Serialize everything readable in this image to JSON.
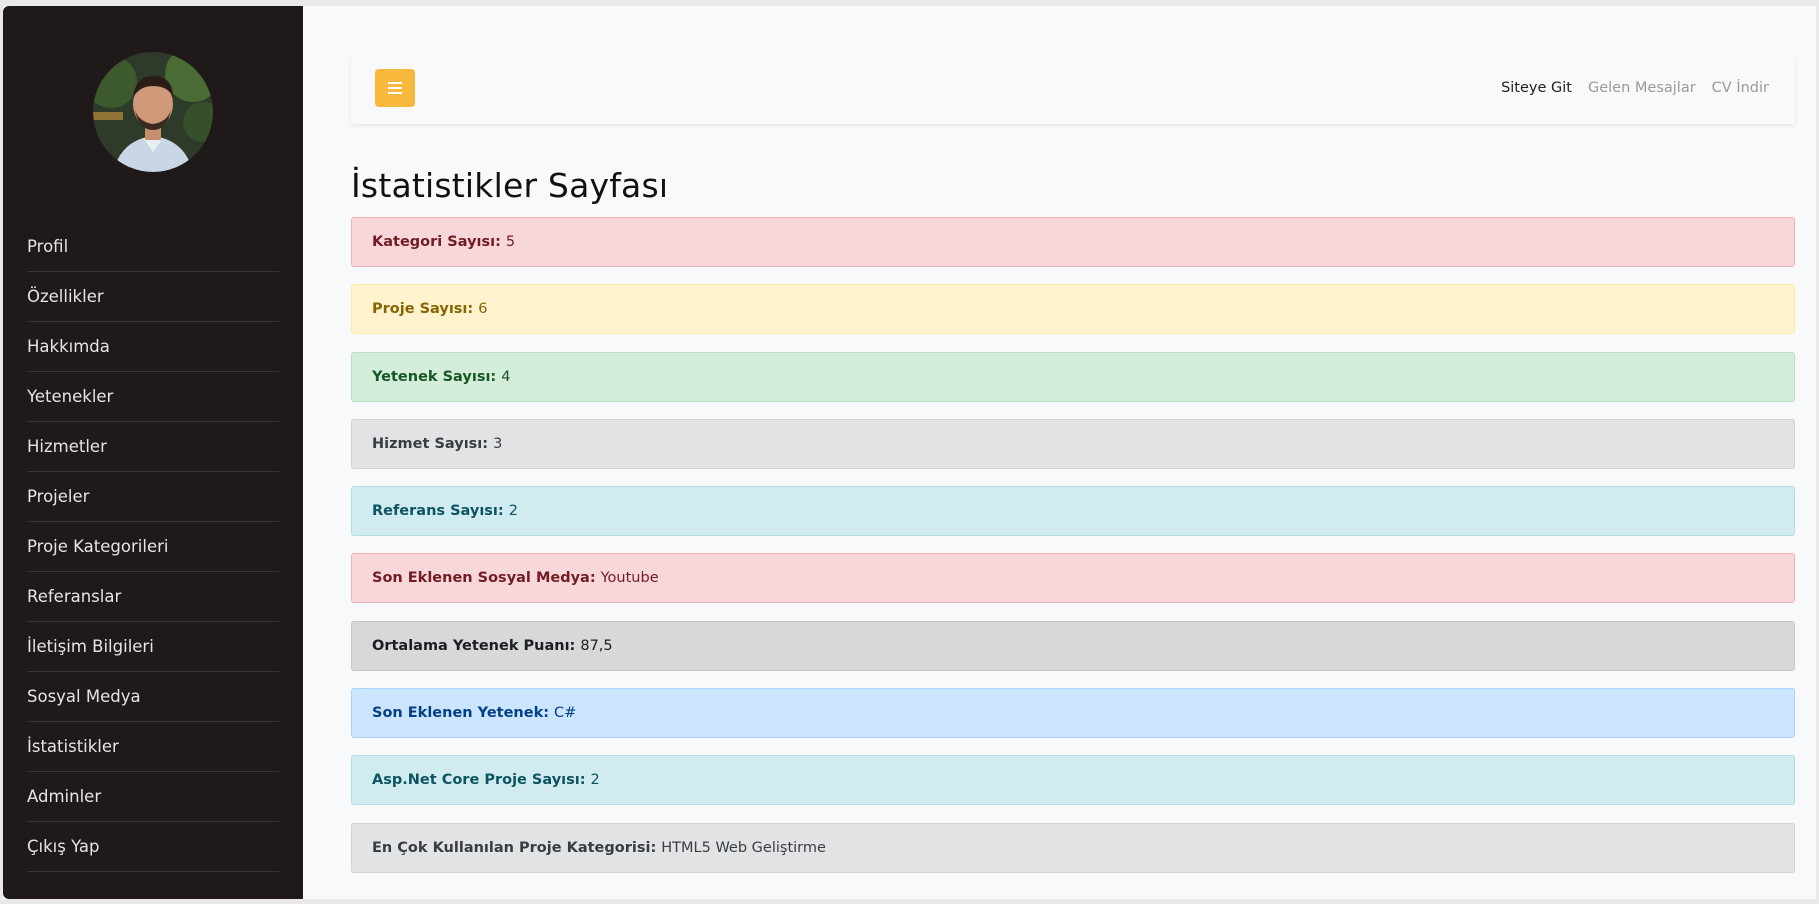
{
  "sidebar": {
    "avatar_alt": "profile-photo",
    "items": [
      {
        "label": "Profil"
      },
      {
        "label": "Özellikler"
      },
      {
        "label": "Hakkımda"
      },
      {
        "label": "Yetenekler"
      },
      {
        "label": "Hizmetler"
      },
      {
        "label": "Projeler"
      },
      {
        "label": "Proje Kategorileri"
      },
      {
        "label": "Referanslar"
      },
      {
        "label": "İletişim Bilgileri"
      },
      {
        "label": "Sosyal Medya"
      },
      {
        "label": "İstatistikler"
      },
      {
        "label": "Adminler"
      },
      {
        "label": "Çıkış Yap"
      }
    ]
  },
  "topbar": {
    "menu_icon": "hamburger-icon",
    "links": [
      {
        "label": "Siteye Git"
      },
      {
        "label": "Gelen Mesajlar"
      },
      {
        "label": "CV İndir"
      }
    ]
  },
  "page": {
    "title": "İstatistikler Sayfası"
  },
  "stats": [
    {
      "label": "Kategori Sayısı:",
      "value": "5",
      "bg": "#f8d7da",
      "border": "#f1b0b7",
      "color": "#721c24"
    },
    {
      "label": "Proje Sayısı:",
      "value": "6",
      "bg": "#fff3cd",
      "border": "#ffe8a1",
      "color": "#856404"
    },
    {
      "label": "Yetenek Sayısı:",
      "value": "4",
      "bg": "#d4edda",
      "border": "#b9dfc2",
      "color": "#155724"
    },
    {
      "label": "Hizmet Sayısı:",
      "value": "3",
      "bg": "#e2e3e5",
      "border": "#cfd1d4",
      "color": "#383d41"
    },
    {
      "label": "Referans Sayısı:",
      "value": "2",
      "bg": "#d1ecf1",
      "border": "#b3dde6",
      "color": "#0c5460"
    },
    {
      "label": "Son Eklenen Sosyal Medya:",
      "value": "Youtube",
      "bg": "#f8d7da",
      "border": "#f1b0b7",
      "color": "#721c24"
    },
    {
      "label": "Ortalama Yetenek Puanı:",
      "value": "87,5",
      "bg": "#d6d8d9",
      "border": "#c3c6c8",
      "color": "#1b1e21"
    },
    {
      "label": "Son Eklenen Yetenek:",
      "value": "C#",
      "bg": "#cce5ff",
      "border": "#abd2fb",
      "color": "#004085"
    },
    {
      "label": "Asp.Net Core Proje Sayısı:",
      "value": "2",
      "bg": "#d1ecf1",
      "border": "#b3dde6",
      "color": "#0c5460"
    },
    {
      "label": "En Çok Kullanılan Proje Kategorisi:",
      "value": "HTML5 Web Geliştirme",
      "bg": "#e2e3e5",
      "border": "#cfd1d4",
      "color": "#383d41"
    }
  ]
}
